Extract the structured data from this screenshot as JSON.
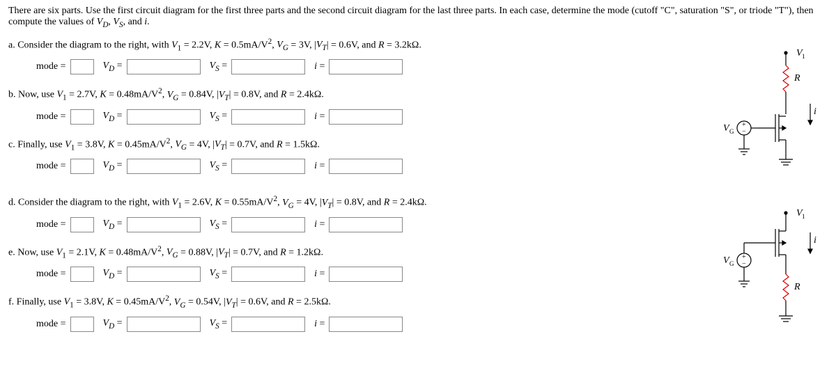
{
  "intro": "There are six parts. Use the first circuit diagram for the first three parts and the second circuit diagram for the last three parts. In each case, determine the mode (cutoff \"C\", saturation \"S\", or triode \"T\"), then compute the values of V_D, V_S, and i.",
  "parts": {
    "a": {
      "prompt_prefix": "a. Consider the diagram to the right, with ",
      "params": "V₁ = 2.2V, K = 0.5mA/V², V_G = 3V, |V_T| = 0.6V, and R = 3.2kΩ."
    },
    "b": {
      "prompt_prefix": "b. Now, use ",
      "params": "V₁ = 2.7V, K = 0.48mA/V², V_G = 0.84V, |V_T| = 0.8V, and R = 2.4kΩ."
    },
    "c": {
      "prompt_prefix": "c. Finally, use ",
      "params": "V₁ = 3.8V, K = 0.45mA/V², V_G = 4V, |V_T| = 0.7V, and R = 1.5kΩ."
    },
    "d": {
      "prompt_prefix": "d. Consider the diagram to the right, with ",
      "params": "V₁ = 2.6V, K = 0.55mA/V², V_G = 4V, |V_T| = 0.8V, and R = 2.4kΩ."
    },
    "e": {
      "prompt_prefix": "e. Now, use ",
      "params": "V₁ = 2.1V, K = 0.48mA/V², V_G = 0.88V, |V_T| = 0.7V, and R = 1.2kΩ."
    },
    "f": {
      "prompt_prefix": "f. Finally, use ",
      "params": "V₁ = 3.8V, K = 0.45mA/V², V_G = 0.54V, |V_T| = 0.6V, and R = 2.5kΩ."
    }
  },
  "labels": {
    "mode": "mode =",
    "vd": "V_D =",
    "vs": "V_S =",
    "i": "i ="
  },
  "circuit_labels": {
    "V1": "V₁",
    "VG": "V_G",
    "R": "R",
    "i": "i"
  }
}
